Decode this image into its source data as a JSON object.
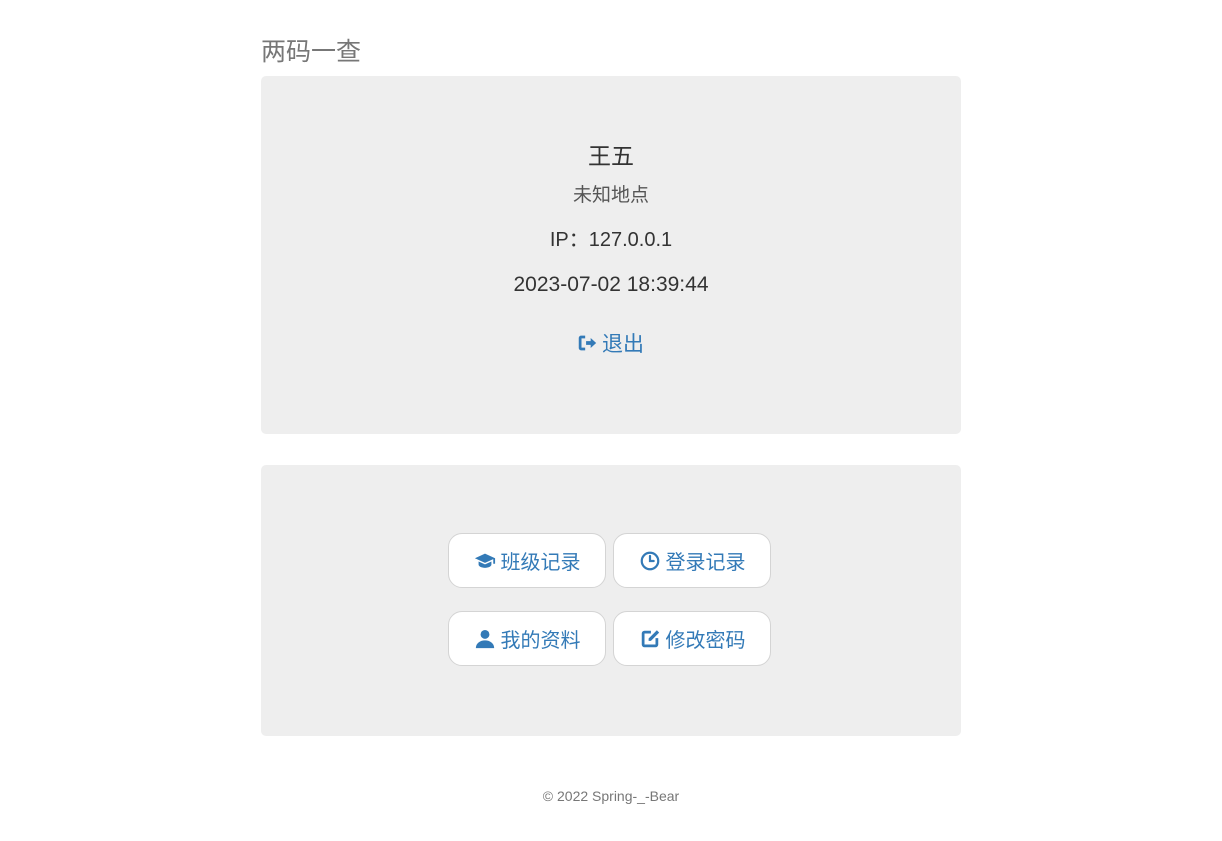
{
  "header": {
    "brand": "两码一查"
  },
  "user_panel": {
    "name": "王五",
    "location": "未知地点",
    "ip": "IP：127.0.0.1",
    "time": "2023-07-02 18:39:44",
    "logout_label": "退出",
    "logout_icon": "log-out-icon"
  },
  "actions": [
    {
      "label": "班级记录",
      "icon": "graduation-cap-icon"
    },
    {
      "label": "登录记录",
      "icon": "clock-icon"
    },
    {
      "label": "我的资料",
      "icon": "user-icon"
    },
    {
      "label": "修改密码",
      "icon": "edit-icon"
    }
  ],
  "footer": {
    "copyright": "© 2022 Spring-_-Bear"
  },
  "colors": {
    "accent": "#337ab7",
    "panel_bg": "#eeeeee",
    "text": "#333333",
    "muted": "#777777"
  }
}
